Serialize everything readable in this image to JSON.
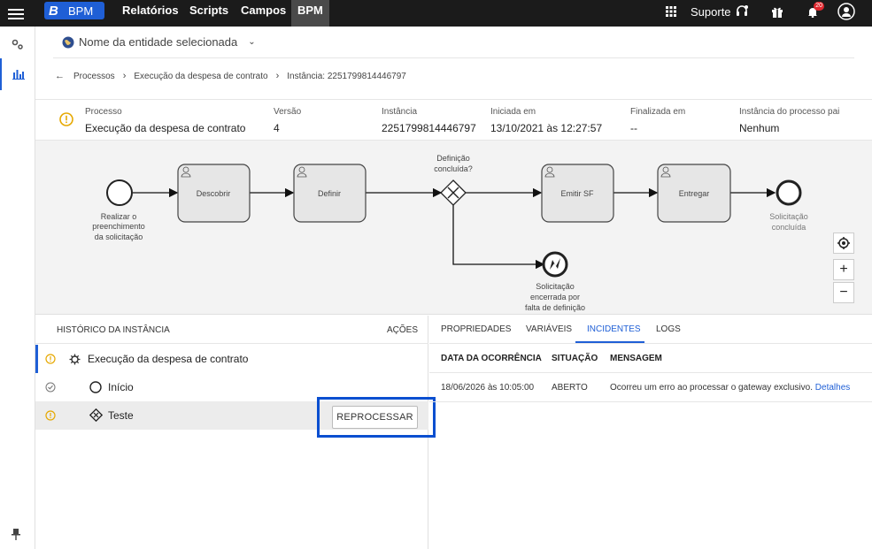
{
  "topbar": {
    "brand_letter": "B",
    "brand_name": "BPM",
    "nav": [
      "Relatórios",
      "Scripts",
      "Campos",
      "BPM"
    ],
    "support_label": "Suporte",
    "notifications_count": "20",
    "accent": "#1f5fd6"
  },
  "entity": {
    "label": "Nome da entidade selecionada"
  },
  "breadcrumb": {
    "items": [
      "Processos",
      "Execução da despesa de contrato",
      "Instância: 2251799814446797"
    ]
  },
  "info": {
    "processo": {
      "label": "Processo",
      "value": "Execução da despesa de contrato"
    },
    "versao": {
      "label": "Versão",
      "value": "4"
    },
    "instancia": {
      "label": "Instância",
      "value": "2251799814446797"
    },
    "iniciada": {
      "label": "Iniciada em",
      "value": "13/10/2021 às 12:27:57"
    },
    "finalizada": {
      "label": "Finalizada em",
      "value": "--"
    },
    "pai": {
      "label": "Instância do processo pai",
      "value": "Nenhum"
    }
  },
  "diagram": {
    "start_label": [
      "Realizar o",
      "preenchimento",
      "da solicitação"
    ],
    "task1": "Descobrir",
    "task2": "Definir",
    "gateway_label": [
      "Definição",
      "concluída?"
    ],
    "task3": "Emitir SF",
    "task4": "Entregar",
    "end_label": [
      "Solicitação",
      "concluída"
    ],
    "error_end_label": [
      "Solicitação",
      "encerrada por",
      "falta de definição"
    ],
    "zoom_in": "+",
    "zoom_out": "−"
  },
  "history": {
    "title": "HISTÓRICO DA INSTÂNCIA",
    "actions": "AÇÕES",
    "rows": [
      {
        "label": "Execução da despesa de contrato"
      },
      {
        "label": "Início"
      },
      {
        "label": "Teste"
      }
    ],
    "reprocess_label": "REPROCESSAR"
  },
  "details": {
    "tabs": [
      "PROPRIEDADES",
      "VARIÁVEIS",
      "INCIDENTES",
      "LOGS"
    ],
    "active_tab": "INCIDENTES",
    "columns": [
      "DATA DA OCORRÊNCIA",
      "SITUAÇÃO",
      "MENSAGEM"
    ],
    "incident": {
      "date": "18/06/2026 às 10:05:00",
      "status": "ABERTO",
      "message": "Ocorreu um erro ao processar o gateway exclusivo.",
      "link": "Detalhes"
    }
  }
}
